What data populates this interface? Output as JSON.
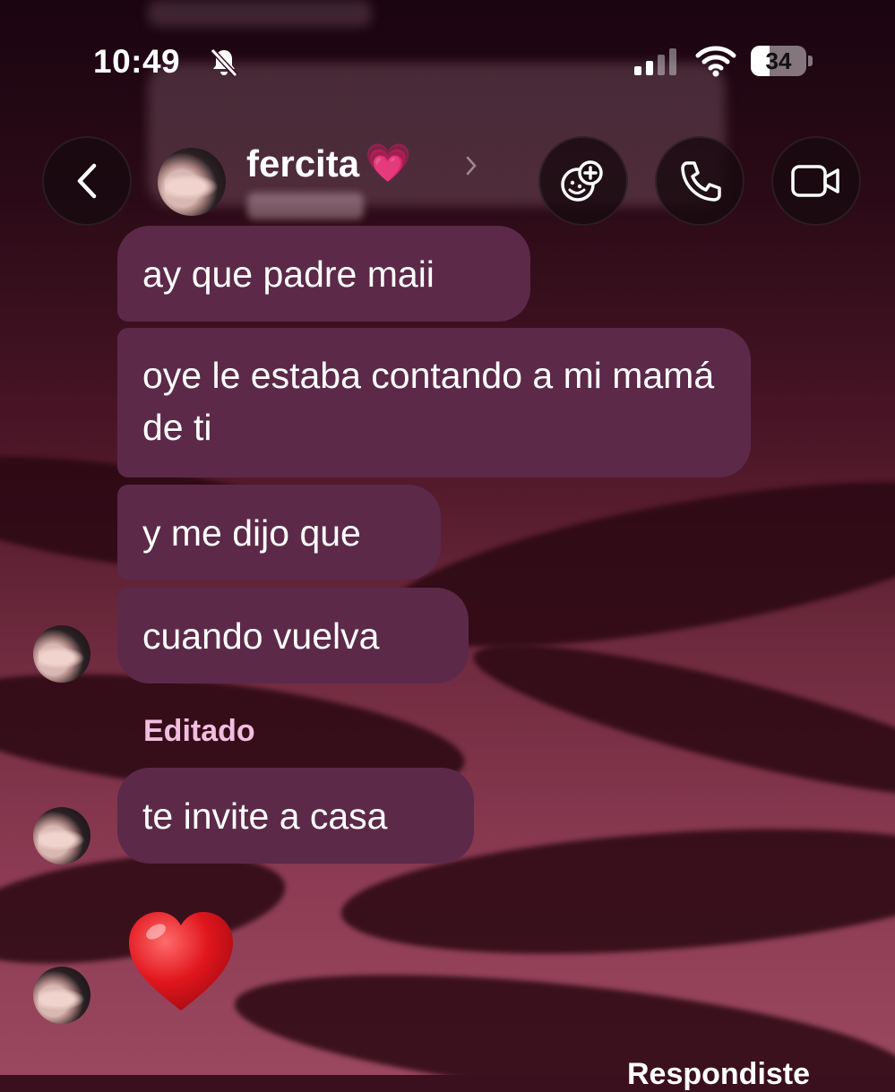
{
  "status_bar": {
    "time": "10:49",
    "battery": "34",
    "battery_level": 0.34,
    "icons": [
      "bell-slash-icon",
      "cellular-signal-icon",
      "wifi-icon",
      "battery-icon"
    ]
  },
  "header": {
    "contact_name": "fercita",
    "name_emoji": "💗",
    "icons": [
      "back-chevron-icon",
      "chevron-right-icon",
      "effects-add-icon",
      "phone-icon",
      "video-camera-icon"
    ]
  },
  "messages": [
    {
      "text": "ay que padre maii"
    },
    {
      "text": "oye le estaba contando a mi mamá de ti"
    },
    {
      "text": "y me dijo que"
    },
    {
      "text": "cuando vuelva"
    },
    {
      "text": "te invite a casa"
    }
  ],
  "edited_label": "Editado",
  "reaction": "❤️",
  "footer": {
    "label": "Respondiste"
  },
  "colors": {
    "bubble": "#5c2949",
    "edited_label": "#f3bde0",
    "header_button_bg": "#190a10"
  }
}
